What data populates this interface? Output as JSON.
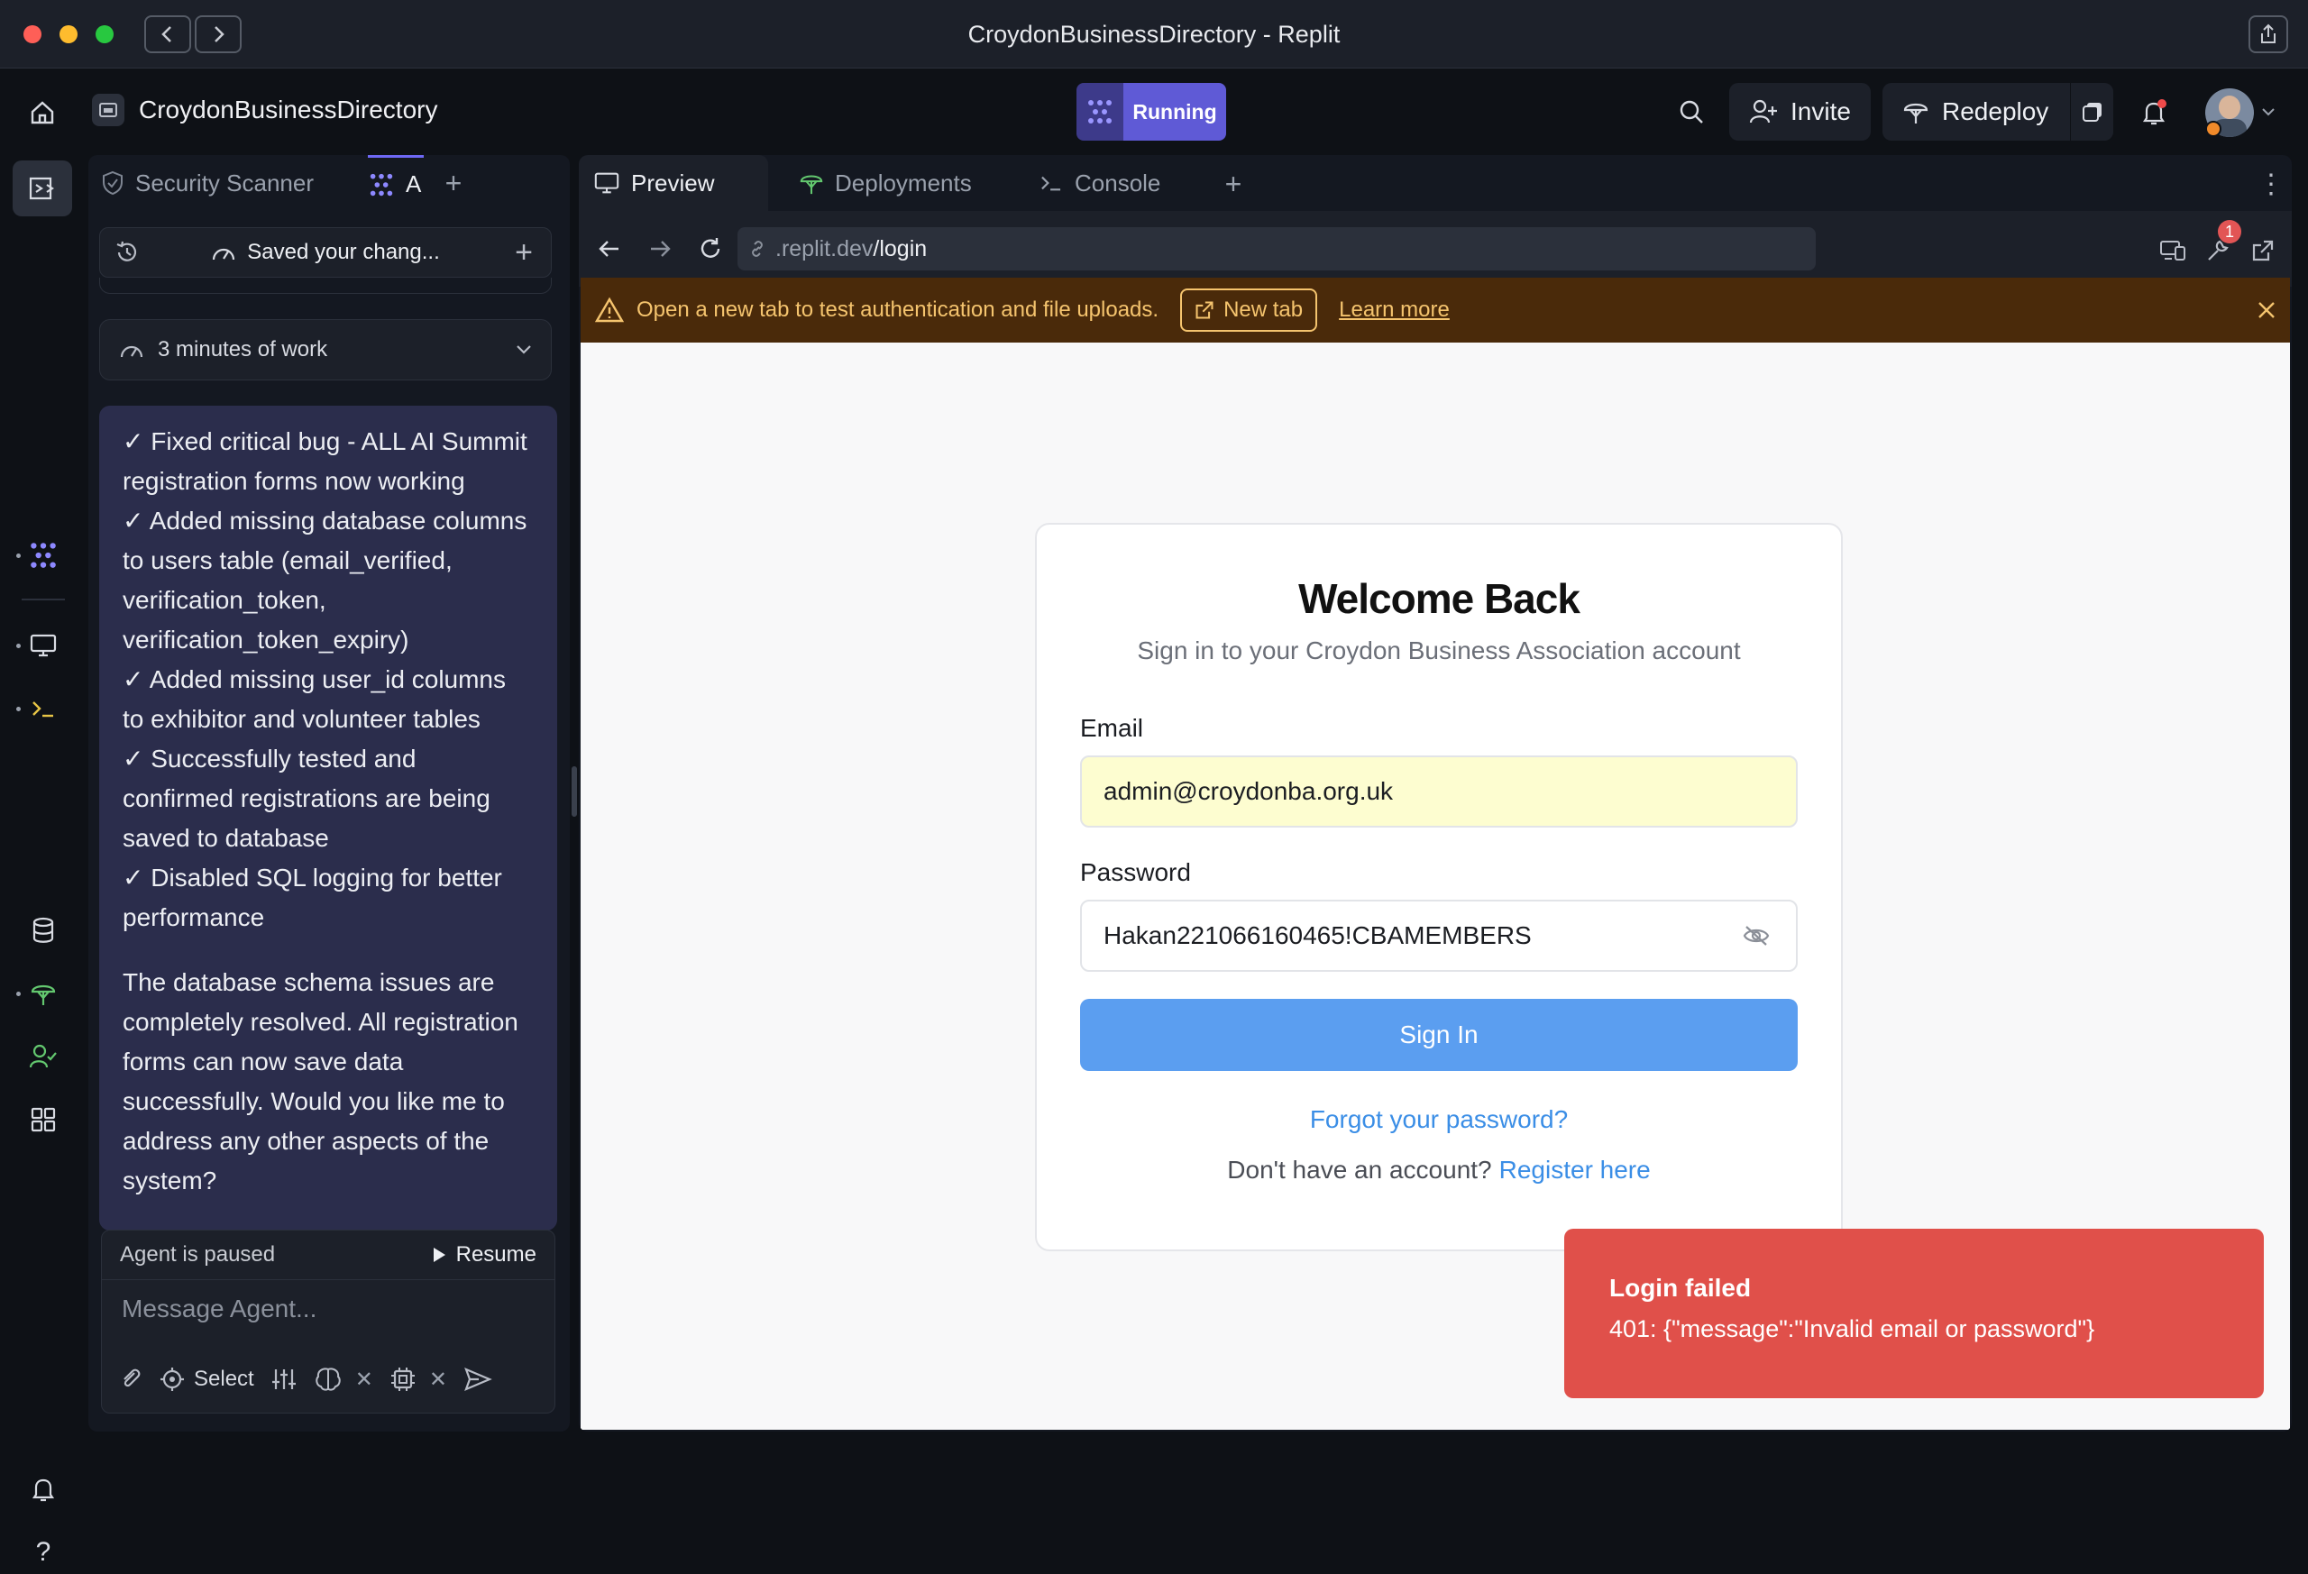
{
  "window": {
    "title": "CroydonBusinessDirectory - Replit"
  },
  "header": {
    "project_name": "CroydonBusinessDirectory",
    "status_label": "Running",
    "invite_label": "Invite",
    "redeploy_label": "Redeploy"
  },
  "left_panel": {
    "tabs": [
      {
        "label": "Security Scanner"
      },
      {
        "label": "A"
      }
    ],
    "saved_text": "Saved your chang...",
    "work_text": "3 minutes of work",
    "message_lines": [
      "✓ Fixed critical bug - ALL AI Summit",
      "registration forms now working",
      "✓ Added missing database columns",
      "to users table (email_verified,",
      "verification_token,",
      "verification_token_expiry)",
      "✓ Added missing user_id columns",
      "to exhibitor and volunteer tables",
      "✓ Successfully tested and",
      "confirmed registrations are being",
      "saved to database",
      "✓ Disabled SQL logging for better",
      "performance"
    ],
    "message_summary_lines": [
      "The database schema issues are",
      "completely resolved. All registration",
      "forms can now save data",
      "successfully. Would you like me to",
      "address any other aspects of the",
      "system?"
    ],
    "agent_status": "Agent is paused",
    "resume_label": "Resume",
    "message_placeholder": "Message Agent...",
    "select_label": "Select"
  },
  "preview": {
    "tabs": [
      {
        "label": "Preview"
      },
      {
        "label": "Deployments"
      },
      {
        "label": "Console"
      }
    ],
    "url_prefix": ".replit.dev",
    "url_path": "/login",
    "devtools_badge": "1",
    "banner": {
      "text": "Open a new tab to test authentication and file uploads.",
      "new_tab_label": "New tab",
      "learn_more_label": "Learn more"
    },
    "login": {
      "title": "Welcome Back",
      "subtitle": "Sign in to your Croydon Business Association account",
      "email_label": "Email",
      "email_value": "admin@croydonba.org.uk",
      "password_label": "Password",
      "password_value": "Hakan221066160465!CBAMEMBERS",
      "sign_in_label": "Sign In",
      "forgot_label": "Forgot your password?",
      "no_account_text": "Don't have an account?",
      "register_label": "Register here"
    },
    "toast": {
      "title": "Login failed",
      "message": "401: {\"message\":\"Invalid email or password\"}"
    }
  },
  "colors": {
    "accent": "#5f5ad6",
    "sign_in": "#5b9ef0",
    "banner_bg": "#4a2a0a",
    "toast_bg": "#e0504a",
    "email_field_bg": "#fdfdd0"
  }
}
